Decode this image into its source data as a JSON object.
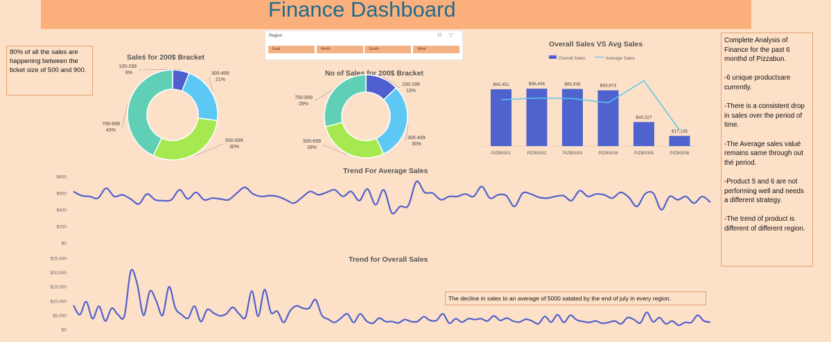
{
  "header": {
    "title": "Finance Dashboard"
  },
  "notes": {
    "left": "80% of all the sales are happening between the ticket size of 500 and 900.",
    "right": [
      "Complete Analysis of Finance for the past 6 monthd of Pizzabun.",
      "-6 unique productsare currently.",
      "-There is a consistent drop in sales over the period of time.",
      "-The Average sales valué remains same through out thé period.",
      "-Product 5 and 6 are not performing well and needs a different strategy.",
      "-The trend of product is different of different region."
    ],
    "bottom": "The decline in sales to an average of 5000 satated by the end of july in every region."
  },
  "slicer": {
    "header": "Region",
    "icons": "☷ ▽",
    "options": [
      "East",
      "North",
      "South",
      "West"
    ]
  },
  "colors": {
    "background": "#fde0c8",
    "title_bar": "#fbb07c",
    "title_text": "#1f6b8e",
    "donut": [
      "#4f5fd0",
      "#5ec8f5",
      "#a6e84f",
      "#5fd0b5"
    ],
    "bar": "#4f63cf",
    "avg_line": "#5bc6ee",
    "trend_line": "#4f60cc"
  },
  "chart_data": [
    {
      "type": "pie",
      "variant": "donut",
      "title": "Saleś for 200$ Bracket",
      "categories": [
        "100-299",
        "300-499",
        "500-699",
        "700-899"
      ],
      "values": [
        6,
        21,
        30,
        43
      ],
      "labels": [
        "6%",
        "21%",
        "30%",
        "43%"
      ]
    },
    {
      "type": "pie",
      "variant": "donut",
      "title": "No of Sales for 200$ Bracket",
      "categories": [
        "100-299",
        "300-499",
        "500-699",
        "700-899"
      ],
      "values": [
        13,
        30,
        28,
        29
      ],
      "labels": [
        "13%",
        "30%",
        "28%",
        "29%"
      ]
    },
    {
      "type": "bar",
      "title": "Overall Sales VS Avg Sales",
      "categories": [
        "PIZB0001",
        "PIZB0002",
        "PIZB0003",
        "PIZB0004",
        "PIZB0005",
        "PIZB0006"
      ],
      "series": [
        {
          "name": "Overall Sales",
          "type": "bar",
          "values": [
            95451,
            96446,
            95936,
            93673,
            40327,
            17135
          ]
        },
        {
          "name": "Average Sales",
          "type": "line",
          "values": [
            535,
            555,
            550,
            500,
            755,
            185
          ]
        }
      ],
      "data_labels": [
        "$95,451",
        "$96,446",
        "$95,936",
        "$93,673",
        "$40,327",
        "$17,135"
      ],
      "legend": "top",
      "grid": false
    },
    {
      "type": "line",
      "title": "Trend For Average Sales",
      "y_ticks": [
        "$0",
        "$200",
        "$400",
        "$600",
        "$800"
      ],
      "ylim": [
        0,
        800
      ],
      "grid": false,
      "values": [
        620,
        570,
        560,
        540,
        660,
        560,
        580,
        530,
        470,
        590,
        520,
        510,
        520,
        640,
        530,
        610,
        520,
        540,
        530,
        520,
        600,
        670,
        590,
        560,
        570,
        560,
        520,
        480,
        550,
        620,
        580,
        610,
        640,
        560,
        620,
        510,
        650,
        460,
        640,
        360,
        440,
        450,
        740,
        610,
        600,
        520,
        560,
        560,
        590,
        560,
        680,
        540,
        580,
        570,
        440,
        600,
        590,
        550,
        540,
        560,
        570,
        510,
        630,
        560,
        590,
        580,
        540,
        610,
        550,
        440,
        590,
        600,
        400,
        560,
        520,
        560,
        480,
        560,
        490
      ]
    },
    {
      "type": "line",
      "title": "Trend for Overall Sales",
      "y_ticks": [
        "$0",
        "$5,000",
        "$10,000",
        "$15,000",
        "$20,000",
        "$25,000"
      ],
      "ylim": [
        0,
        25000
      ],
      "grid": false,
      "values": [
        8500,
        5200,
        9800,
        3800,
        8200,
        3000,
        7500,
        5200,
        4800,
        20500,
        16000,
        5000,
        13500,
        10000,
        5000,
        15000,
        7500,
        5200,
        4000,
        8200,
        2800,
        7000,
        5800,
        4800,
        5500,
        7800,
        5500,
        4300,
        13500,
        4600,
        14000,
        6000,
        6400,
        2500,
        6500,
        8300,
        7500,
        7500,
        10500,
        5000,
        3600,
        2500,
        4000,
        5500,
        2500,
        5500,
        3000,
        2200,
        4000,
        2800,
        2800,
        2300,
        3500,
        2800,
        2800,
        4500,
        3200,
        3200,
        5500,
        2200,
        3800,
        2600,
        3800,
        3500,
        3800,
        3000,
        4800,
        3200,
        4000,
        3000,
        2600,
        3600,
        3000,
        2000,
        4600,
        2600,
        5200,
        2500,
        5000,
        3400,
        2800,
        2500,
        3000,
        2200,
        2500,
        3000,
        2000,
        4200,
        3500,
        2300,
        6000,
        2700,
        4200,
        2000,
        3000,
        1500,
        2500,
        2500,
        5000,
        3000,
        2600
      ]
    }
  ]
}
